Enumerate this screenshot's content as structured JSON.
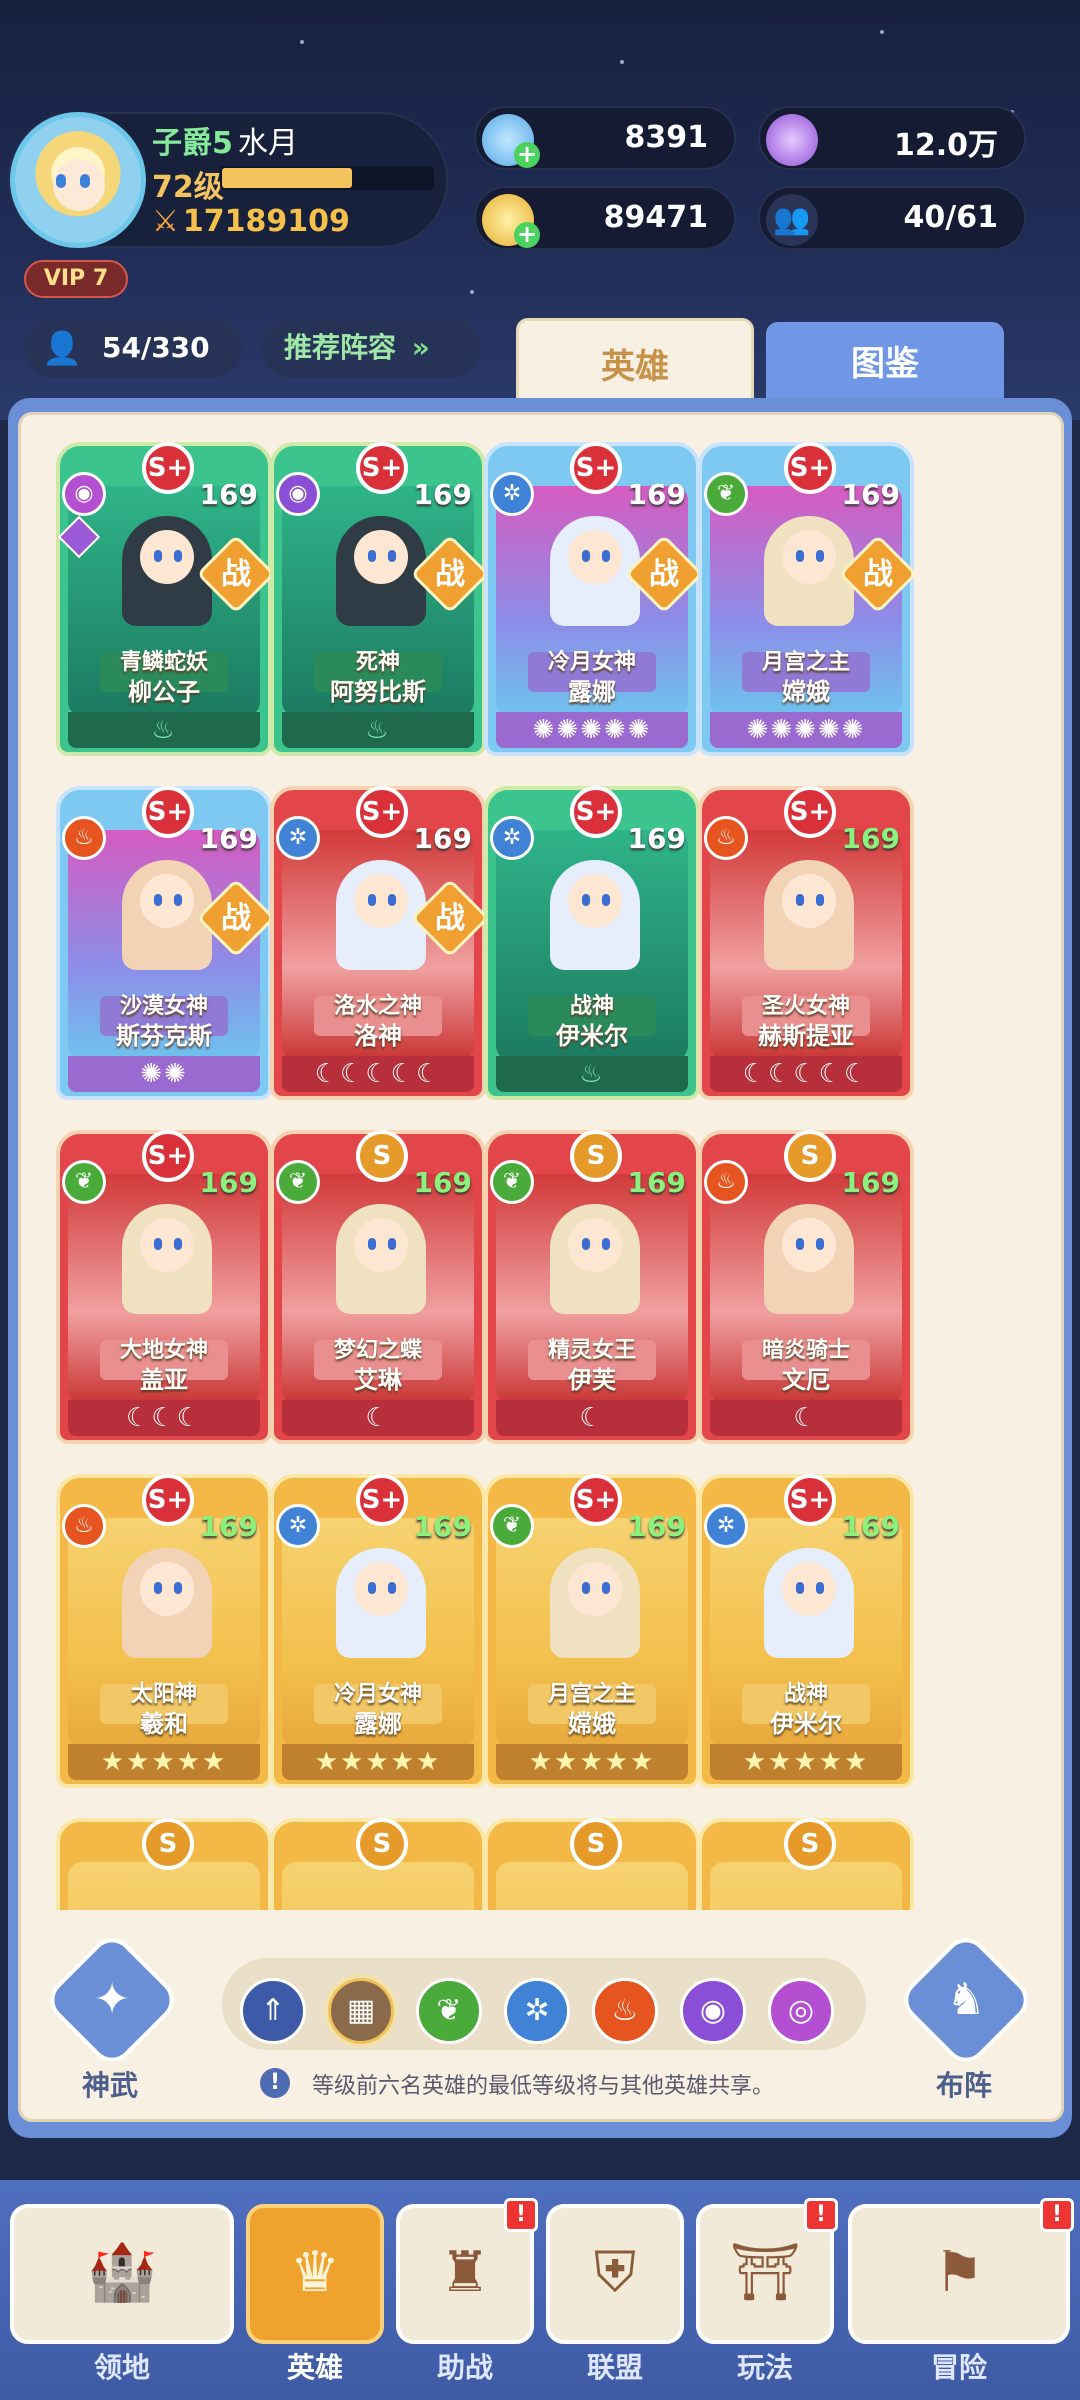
{
  "player": {
    "rank": "子爵5",
    "name": "水月",
    "level": "72级",
    "xp_fraction": 0.62,
    "power": "17189109",
    "vip": "VIP 7"
  },
  "currencies": [
    {
      "icon": "blue-star-icon",
      "value": "8391"
    },
    {
      "icon": "purple-orb-icon",
      "value": "12.0万"
    },
    {
      "icon": "gold-coin-icon",
      "value": "89471"
    },
    {
      "icon": "people-icon",
      "value": "40/61"
    }
  ],
  "roster": {
    "count": "54/330",
    "recommend": "推荐阵容"
  },
  "tabs": {
    "heroes": "英雄",
    "codex": "图鉴"
  },
  "heroes": [
    {
      "grade": "S+",
      "level": "169",
      "title": "青鳞蛇妖",
      "name": "柳公子",
      "element": "dark",
      "color": "green",
      "foot": "flame",
      "battle": true
    },
    {
      "grade": "S+",
      "level": "169",
      "title": "死神",
      "name": "阿努比斯",
      "element": "void",
      "color": "green",
      "foot": "flame",
      "battle": true
    },
    {
      "grade": "S+",
      "level": "169",
      "title": "冷月女神",
      "name": "露娜",
      "element": "ice",
      "color": "blue",
      "foot": "✺✺✺✺✺",
      "battle": true
    },
    {
      "grade": "S+",
      "level": "169",
      "title": "月宫之主",
      "name": "嫦娥",
      "element": "wind",
      "color": "blue",
      "foot": "✺✺✺✺✺",
      "battle": true
    },
    {
      "grade": "S+",
      "level": "169",
      "title": "沙漠女神",
      "name": "斯芬克斯",
      "element": "fire",
      "color": "blue",
      "foot": "✺✺",
      "battle": true
    },
    {
      "grade": "S+",
      "level": "169",
      "title": "洛水之神",
      "name": "洛神",
      "element": "ice",
      "color": "red",
      "foot": "☾☾☾☾☾",
      "battle": true
    },
    {
      "grade": "S+",
      "level": "169",
      "title": "战神",
      "name": "伊米尔",
      "element": "ice",
      "color": "green",
      "foot": "flame",
      "battle": false
    },
    {
      "grade": "S+",
      "level": "169",
      "title": "圣火女神",
      "name": "赫斯提亚",
      "element": "fire",
      "color": "red",
      "foot": "☾☾☾☾☾",
      "battle": false
    },
    {
      "grade": "S+",
      "level": "169",
      "title": "大地女神",
      "name": "盖亚",
      "element": "wind",
      "color": "red",
      "foot": "☾☾☾",
      "battle": false
    },
    {
      "grade": "S",
      "level": "169",
      "title": "梦幻之蝶",
      "name": "艾琳",
      "element": "wind",
      "color": "red",
      "foot": "☾",
      "battle": false
    },
    {
      "grade": "S",
      "level": "169",
      "title": "精灵女王",
      "name": "伊芙",
      "element": "wind",
      "color": "red",
      "foot": "☾",
      "battle": false
    },
    {
      "grade": "S",
      "level": "169",
      "title": "暗炎骑士",
      "name": "文厄",
      "element": "fire",
      "color": "red",
      "foot": "☾",
      "battle": false
    },
    {
      "grade": "S+",
      "level": "169",
      "title": "太阳神",
      "name": "羲和",
      "element": "fire",
      "color": "gold",
      "foot": "★★★★★",
      "battle": false
    },
    {
      "grade": "S+",
      "level": "169",
      "title": "冷月女神",
      "name": "露娜",
      "element": "ice",
      "color": "gold",
      "foot": "★★★★★",
      "battle": false
    },
    {
      "grade": "S+",
      "level": "169",
      "title": "月宫之主",
      "name": "嫦娥",
      "element": "wind",
      "color": "gold",
      "foot": "★★★★★",
      "battle": false
    },
    {
      "grade": "S+",
      "level": "169",
      "title": "战神",
      "name": "伊米尔",
      "element": "ice",
      "color": "gold",
      "foot": "★★★★★",
      "battle": false
    },
    {
      "grade": "S",
      "level": "",
      "title": "",
      "name": "",
      "element": "",
      "color": "gold",
      "foot": "",
      "battle": false
    },
    {
      "grade": "S",
      "level": "",
      "title": "",
      "name": "",
      "element": "",
      "color": "gold",
      "foot": "",
      "battle": false
    },
    {
      "grade": "S",
      "level": "",
      "title": "",
      "name": "",
      "element": "",
      "color": "gold",
      "foot": "",
      "battle": false
    },
    {
      "grade": "S",
      "level": "",
      "title": "",
      "name": "",
      "element": "",
      "color": "gold",
      "foot": "",
      "battle": false
    }
  ],
  "battle_label": "战",
  "controls": {
    "left_label": "神武",
    "right_label": "布阵",
    "hint": "等级前六名英雄的最低等级将与其他英雄共享。",
    "filters": [
      "sort-up-icon",
      "all-grid-icon",
      "wind-element-icon",
      "ice-element-icon",
      "fire-element-icon",
      "void-element-icon",
      "dark-element-icon"
    ]
  },
  "nav": [
    {
      "label": "领地",
      "icon": "castle-icon",
      "alert": false
    },
    {
      "label": "英雄",
      "icon": "hero-icon",
      "alert": false,
      "active": true
    },
    {
      "label": "助战",
      "icon": "support-icon",
      "alert": true
    },
    {
      "label": "联盟",
      "icon": "shield-icon",
      "alert": false
    },
    {
      "label": "玩法",
      "icon": "gate-icon",
      "alert": true
    },
    {
      "label": "冒险",
      "icon": "flag-icon",
      "alert": true
    }
  ],
  "colors": {
    "gold": "#f3c45e",
    "green_name": "#86e89a",
    "panel": "#6b8fd6",
    "paper": "#f8f0e2"
  }
}
